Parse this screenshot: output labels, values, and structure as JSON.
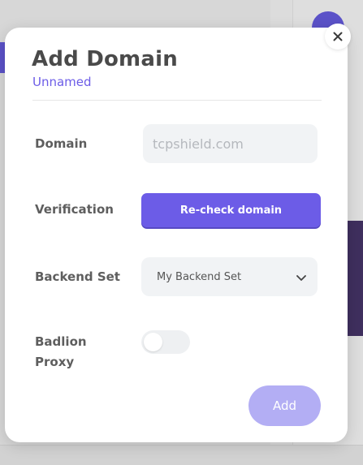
{
  "modal": {
    "title": "Add Domain",
    "subtitle": "Unnamed",
    "fields": {
      "domain_label": "Domain",
      "domain_placeholder": "tcpshield.com",
      "domain_value": "",
      "verification_label": "Verification",
      "recheck_button": "Re-check domain",
      "backend_label": "Backend Set",
      "backend_selected": "My Backend Set",
      "badlion_label": "Badlion Proxy",
      "badlion_enabled": false
    },
    "add_button": "Add"
  },
  "colors": {
    "accent": "#6c5ce7",
    "accent_disabled": "#b3aef4",
    "title": "#4a4a4a",
    "label": "#5e5e5e"
  },
  "icons": {
    "close": "close-icon",
    "dropdown": "chevron-down-icon"
  }
}
